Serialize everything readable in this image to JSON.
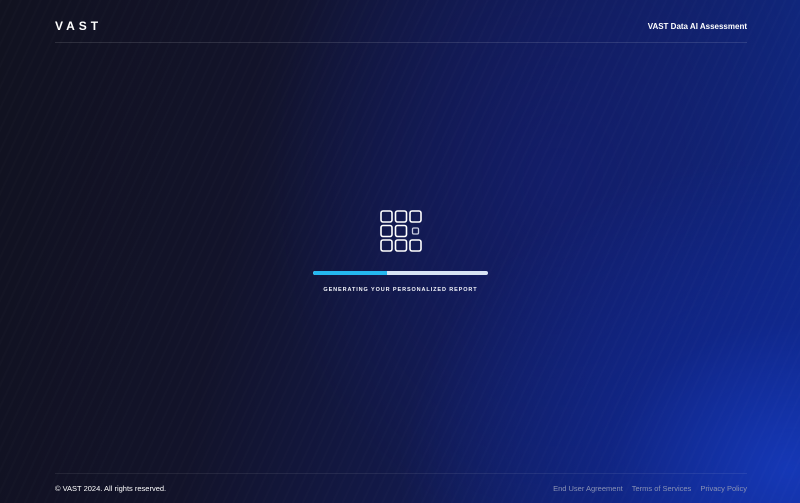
{
  "header": {
    "logo_text": "VAST",
    "title": "VAST Data AI Assessment"
  },
  "loader": {
    "icon": "grid-icon",
    "progress": 0.42,
    "message": "GENERATING YOUR PERSONALIZED REPORT"
  },
  "footer": {
    "copyright": "© VAST 2024. All rights reserved.",
    "links": [
      {
        "label": "End User Agreement"
      },
      {
        "label": "Terms of Services"
      },
      {
        "label": "Privacy Policy"
      }
    ]
  },
  "colors": {
    "progress_fill": "#25b8ef",
    "progress_track": "#d8e4f4",
    "background_dark": "#111220",
    "background_accent": "#0f2a8a",
    "footer_link": "#8a93b5"
  }
}
